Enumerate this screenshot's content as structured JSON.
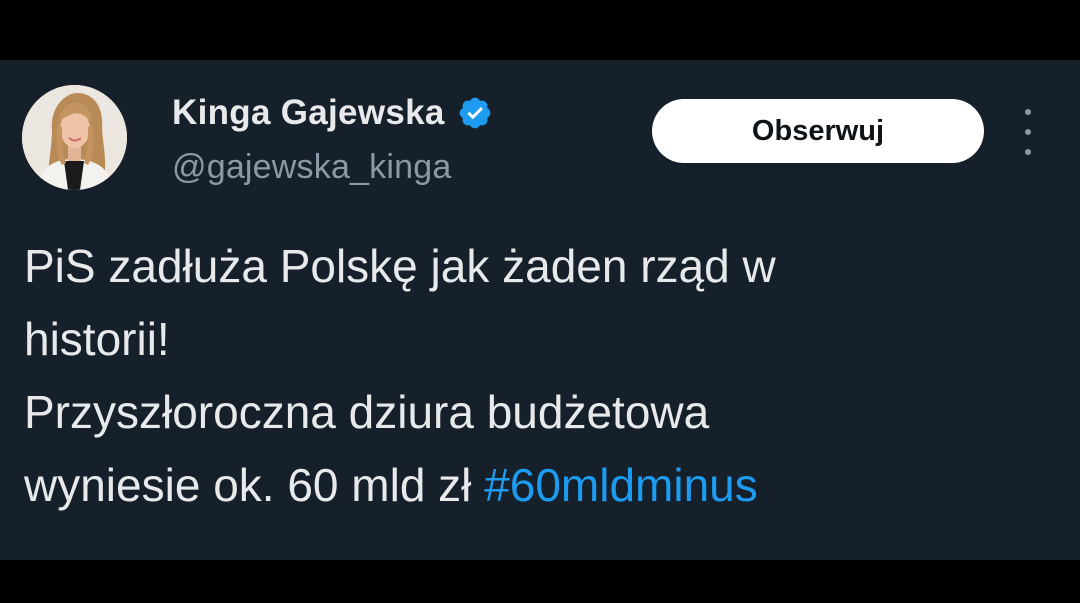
{
  "tweet": {
    "author": {
      "display_name": "Kinga Gajewska",
      "handle": "@gajewska_kinga",
      "verified": true,
      "avatar_icon": "profile-photo"
    },
    "follow_button_label": "Obserwuj",
    "more_icon": "more-vertical-icon",
    "text_lines": {
      "line1": "PiS zadłuża Polskę jak żaden rząd w",
      "line2": "historii!",
      "line3": "Przyszłoroczna dziura budżetowa",
      "line4": "wyniesie ok. 60 mld zł "
    },
    "hashtag": "#60mldminus"
  },
  "colors": {
    "background": "#000000",
    "card": "#15202b",
    "text": "#e7e9ea",
    "muted": "#8b98a5",
    "accent": "#1d9bf0",
    "button_bg": "#ffffff",
    "button_text": "#0f1419"
  }
}
